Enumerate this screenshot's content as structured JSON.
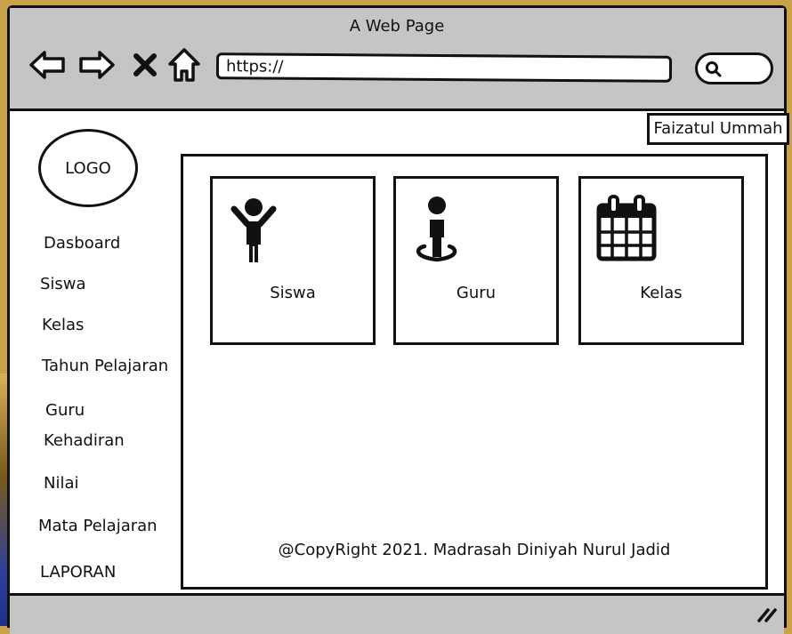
{
  "window": {
    "title": "A Web Page"
  },
  "toolbar": {
    "back_icon": "arrow-left-icon",
    "forward_icon": "arrow-right-icon",
    "close_icon": "x-icon",
    "home_icon": "home-icon",
    "url": "https://",
    "search_icon": "search-icon"
  },
  "header": {
    "user_name": "Faizatul Ummah"
  },
  "logo": {
    "label": "LOGO"
  },
  "sidebar": {
    "items": [
      {
        "label": "Dasboard"
      },
      {
        "label": "Siswa"
      },
      {
        "label": "Kelas"
      },
      {
        "label": "Tahun Pelajaran"
      },
      {
        "label": "Guru"
      },
      {
        "label": "Kehadiran"
      },
      {
        "label": "Nilai"
      },
      {
        "label": "Mata Pelajaran"
      },
      {
        "label": "LAPORAN"
      }
    ]
  },
  "main": {
    "cards": [
      {
        "label": "Siswa",
        "icon": "child-person-icon"
      },
      {
        "label": "Guru",
        "icon": "person-standing-icon"
      },
      {
        "label": "Kelas",
        "icon": "calendar-icon"
      }
    ],
    "footer_text": "@CopyRight 2021. Madrasah Diniyah Nurul Jadid"
  },
  "colors": {
    "window_chrome": "#c5c5c5",
    "content_bg": "#ffffff",
    "ink": "#111111"
  }
}
